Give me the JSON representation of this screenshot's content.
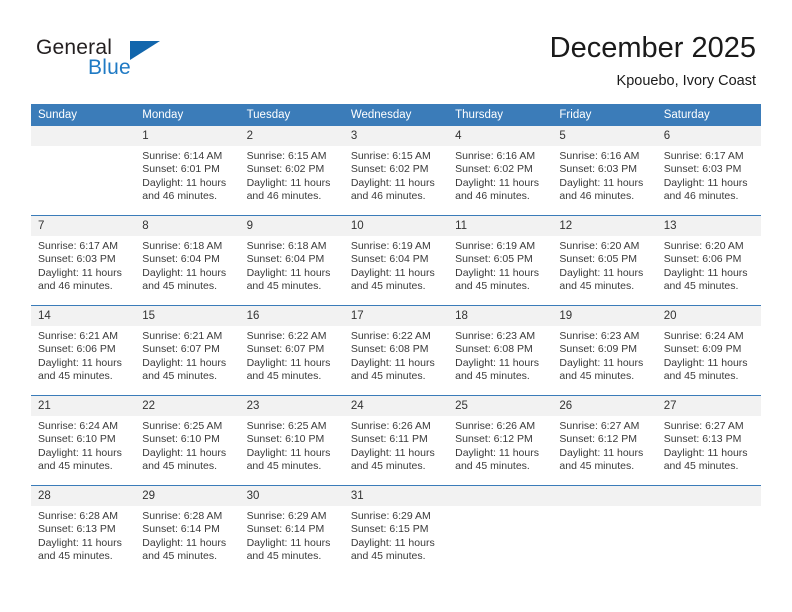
{
  "brand": {
    "word_one": "General",
    "word_two": "Blue",
    "accent_color": "#1266ac",
    "text_color": "#231f20"
  },
  "header": {
    "month_title": "December 2025",
    "location": "Kpouebo, Ivory Coast"
  },
  "calendar": {
    "header_bg": "#3b7cb9",
    "daynum_bg": "#f2f2f2",
    "weekdays": [
      "Sunday",
      "Monday",
      "Tuesday",
      "Wednesday",
      "Thursday",
      "Friday",
      "Saturday"
    ],
    "weeks": [
      [
        {
          "day": "",
          "blank": true
        },
        {
          "day": "1",
          "sunrise": "Sunrise: 6:14 AM",
          "sunset": "Sunset: 6:01 PM",
          "daylight_1": "Daylight: 11 hours",
          "daylight_2": "and 46 minutes."
        },
        {
          "day": "2",
          "sunrise": "Sunrise: 6:15 AM",
          "sunset": "Sunset: 6:02 PM",
          "daylight_1": "Daylight: 11 hours",
          "daylight_2": "and 46 minutes."
        },
        {
          "day": "3",
          "sunrise": "Sunrise: 6:15 AM",
          "sunset": "Sunset: 6:02 PM",
          "daylight_1": "Daylight: 11 hours",
          "daylight_2": "and 46 minutes."
        },
        {
          "day": "4",
          "sunrise": "Sunrise: 6:16 AM",
          "sunset": "Sunset: 6:02 PM",
          "daylight_1": "Daylight: 11 hours",
          "daylight_2": "and 46 minutes."
        },
        {
          "day": "5",
          "sunrise": "Sunrise: 6:16 AM",
          "sunset": "Sunset: 6:03 PM",
          "daylight_1": "Daylight: 11 hours",
          "daylight_2": "and 46 minutes."
        },
        {
          "day": "6",
          "sunrise": "Sunrise: 6:17 AM",
          "sunset": "Sunset: 6:03 PM",
          "daylight_1": "Daylight: 11 hours",
          "daylight_2": "and 46 minutes."
        }
      ],
      [
        {
          "day": "7",
          "sunrise": "Sunrise: 6:17 AM",
          "sunset": "Sunset: 6:03 PM",
          "daylight_1": "Daylight: 11 hours",
          "daylight_2": "and 46 minutes."
        },
        {
          "day": "8",
          "sunrise": "Sunrise: 6:18 AM",
          "sunset": "Sunset: 6:04 PM",
          "daylight_1": "Daylight: 11 hours",
          "daylight_2": "and 45 minutes."
        },
        {
          "day": "9",
          "sunrise": "Sunrise: 6:18 AM",
          "sunset": "Sunset: 6:04 PM",
          "daylight_1": "Daylight: 11 hours",
          "daylight_2": "and 45 minutes."
        },
        {
          "day": "10",
          "sunrise": "Sunrise: 6:19 AM",
          "sunset": "Sunset: 6:04 PM",
          "daylight_1": "Daylight: 11 hours",
          "daylight_2": "and 45 minutes."
        },
        {
          "day": "11",
          "sunrise": "Sunrise: 6:19 AM",
          "sunset": "Sunset: 6:05 PM",
          "daylight_1": "Daylight: 11 hours",
          "daylight_2": "and 45 minutes."
        },
        {
          "day": "12",
          "sunrise": "Sunrise: 6:20 AM",
          "sunset": "Sunset: 6:05 PM",
          "daylight_1": "Daylight: 11 hours",
          "daylight_2": "and 45 minutes."
        },
        {
          "day": "13",
          "sunrise": "Sunrise: 6:20 AM",
          "sunset": "Sunset: 6:06 PM",
          "daylight_1": "Daylight: 11 hours",
          "daylight_2": "and 45 minutes."
        }
      ],
      [
        {
          "day": "14",
          "sunrise": "Sunrise: 6:21 AM",
          "sunset": "Sunset: 6:06 PM",
          "daylight_1": "Daylight: 11 hours",
          "daylight_2": "and 45 minutes."
        },
        {
          "day": "15",
          "sunrise": "Sunrise: 6:21 AM",
          "sunset": "Sunset: 6:07 PM",
          "daylight_1": "Daylight: 11 hours",
          "daylight_2": "and 45 minutes."
        },
        {
          "day": "16",
          "sunrise": "Sunrise: 6:22 AM",
          "sunset": "Sunset: 6:07 PM",
          "daylight_1": "Daylight: 11 hours",
          "daylight_2": "and 45 minutes."
        },
        {
          "day": "17",
          "sunrise": "Sunrise: 6:22 AM",
          "sunset": "Sunset: 6:08 PM",
          "daylight_1": "Daylight: 11 hours",
          "daylight_2": "and 45 minutes."
        },
        {
          "day": "18",
          "sunrise": "Sunrise: 6:23 AM",
          "sunset": "Sunset: 6:08 PM",
          "daylight_1": "Daylight: 11 hours",
          "daylight_2": "and 45 minutes."
        },
        {
          "day": "19",
          "sunrise": "Sunrise: 6:23 AM",
          "sunset": "Sunset: 6:09 PM",
          "daylight_1": "Daylight: 11 hours",
          "daylight_2": "and 45 minutes."
        },
        {
          "day": "20",
          "sunrise": "Sunrise: 6:24 AM",
          "sunset": "Sunset: 6:09 PM",
          "daylight_1": "Daylight: 11 hours",
          "daylight_2": "and 45 minutes."
        }
      ],
      [
        {
          "day": "21",
          "sunrise": "Sunrise: 6:24 AM",
          "sunset": "Sunset: 6:10 PM",
          "daylight_1": "Daylight: 11 hours",
          "daylight_2": "and 45 minutes."
        },
        {
          "day": "22",
          "sunrise": "Sunrise: 6:25 AM",
          "sunset": "Sunset: 6:10 PM",
          "daylight_1": "Daylight: 11 hours",
          "daylight_2": "and 45 minutes."
        },
        {
          "day": "23",
          "sunrise": "Sunrise: 6:25 AM",
          "sunset": "Sunset: 6:10 PM",
          "daylight_1": "Daylight: 11 hours",
          "daylight_2": "and 45 minutes."
        },
        {
          "day": "24",
          "sunrise": "Sunrise: 6:26 AM",
          "sunset": "Sunset: 6:11 PM",
          "daylight_1": "Daylight: 11 hours",
          "daylight_2": "and 45 minutes."
        },
        {
          "day": "25",
          "sunrise": "Sunrise: 6:26 AM",
          "sunset": "Sunset: 6:12 PM",
          "daylight_1": "Daylight: 11 hours",
          "daylight_2": "and 45 minutes."
        },
        {
          "day": "26",
          "sunrise": "Sunrise: 6:27 AM",
          "sunset": "Sunset: 6:12 PM",
          "daylight_1": "Daylight: 11 hours",
          "daylight_2": "and 45 minutes."
        },
        {
          "day": "27",
          "sunrise": "Sunrise: 6:27 AM",
          "sunset": "Sunset: 6:13 PM",
          "daylight_1": "Daylight: 11 hours",
          "daylight_2": "and 45 minutes."
        }
      ],
      [
        {
          "day": "28",
          "sunrise": "Sunrise: 6:28 AM",
          "sunset": "Sunset: 6:13 PM",
          "daylight_1": "Daylight: 11 hours",
          "daylight_2": "and 45 minutes."
        },
        {
          "day": "29",
          "sunrise": "Sunrise: 6:28 AM",
          "sunset": "Sunset: 6:14 PM",
          "daylight_1": "Daylight: 11 hours",
          "daylight_2": "and 45 minutes."
        },
        {
          "day": "30",
          "sunrise": "Sunrise: 6:29 AM",
          "sunset": "Sunset: 6:14 PM",
          "daylight_1": "Daylight: 11 hours",
          "daylight_2": "and 45 minutes."
        },
        {
          "day": "31",
          "sunrise": "Sunrise: 6:29 AM",
          "sunset": "Sunset: 6:15 PM",
          "daylight_1": "Daylight: 11 hours",
          "daylight_2": "and 45 minutes."
        },
        {
          "day": "",
          "blank": true
        },
        {
          "day": "",
          "blank": true
        },
        {
          "day": "",
          "blank": true
        }
      ]
    ]
  }
}
